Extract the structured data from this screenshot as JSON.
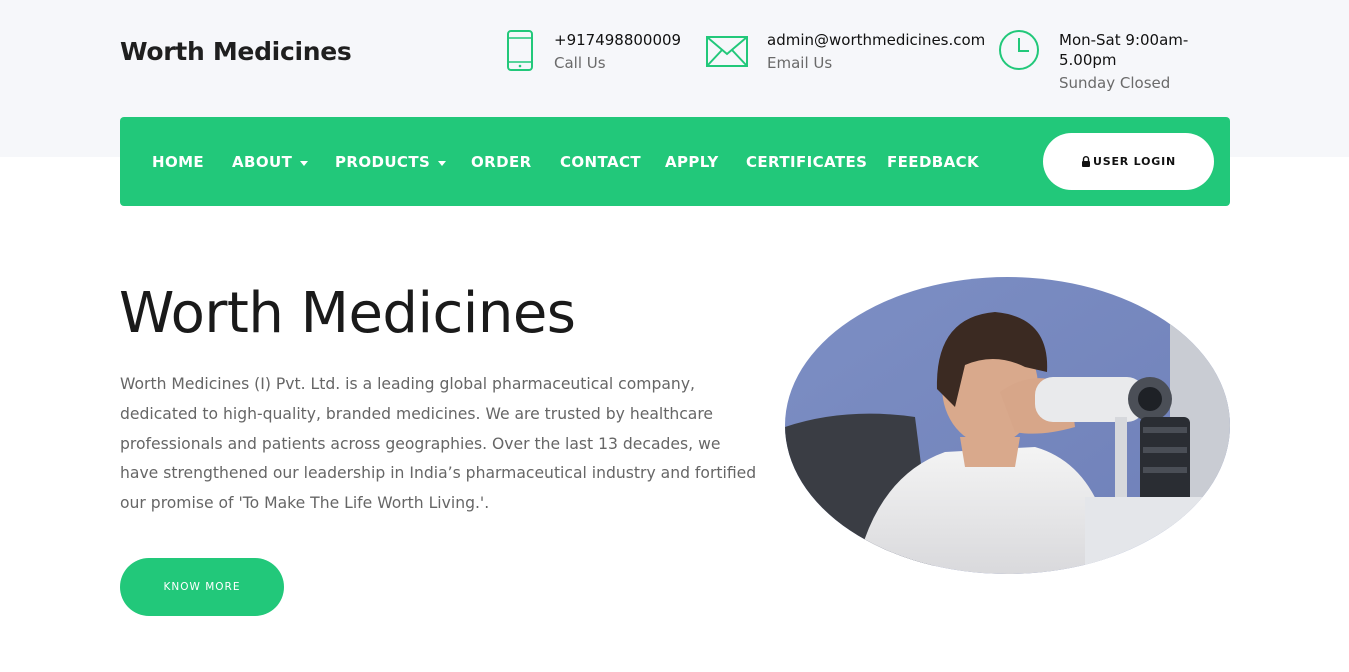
{
  "header": {
    "brand": "Worth Medicines",
    "contacts": [
      {
        "icon": "phone-icon",
        "main": "+917498800009",
        "sub": "Call Us"
      },
      {
        "icon": "envelope-icon",
        "main": "admin@worthmedicines.com",
        "sub": "Email Us"
      },
      {
        "icon": "clock-icon",
        "main": "Mon-Sat 9:00am-5.00pm",
        "sub": "Sunday Closed"
      }
    ]
  },
  "nav": {
    "items": [
      {
        "label": "HOME",
        "dropdown": false
      },
      {
        "label": "ABOUT",
        "dropdown": true
      },
      {
        "label": "PRODUCTS",
        "dropdown": true
      },
      {
        "label": "ORDER",
        "dropdown": false
      },
      {
        "label": "CONTACT",
        "dropdown": false
      },
      {
        "label": "APPLY",
        "dropdown": false
      },
      {
        "label": "CERTIFICATES",
        "dropdown": false
      },
      {
        "label": "FEEDBACK",
        "dropdown": false
      }
    ],
    "login_label": "USER LOGIN",
    "login_icon": "lock-icon"
  },
  "hero": {
    "title": "Worth Medicines",
    "description": "Worth Medicines (I) Pvt. Ltd. is a leading global pharmaceutical company, dedicated to high-quality, branded medicines. We are trusted by healthcare professionals and patients across geographies. Over the last 13 decades, we have strengthened our leadership in India’s pharmaceutical industry and fortified our promise of 'To Make The Life Worth Living.'.",
    "button_label": "KNOW MORE",
    "image_icon": "doctor-eye-exam-photo"
  },
  "colors": {
    "accent": "#22c87a",
    "top_band": "#f6f7fa",
    "text_dark": "#1a1a1a",
    "text_muted": "#666666"
  }
}
